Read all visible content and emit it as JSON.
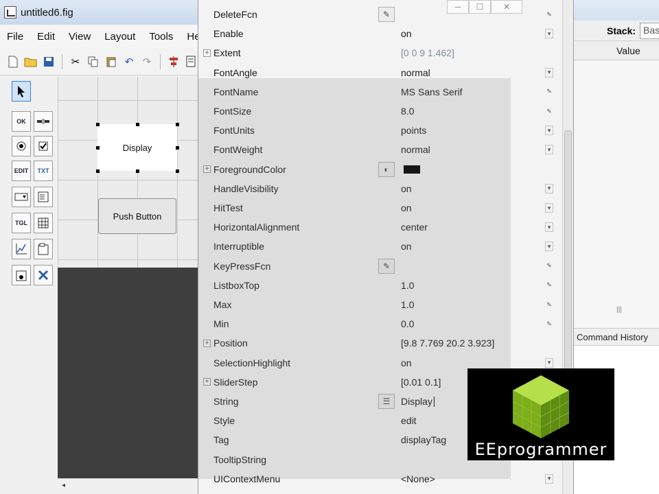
{
  "guide": {
    "title": "untitled6.fig",
    "menus": [
      "File",
      "Edit",
      "View",
      "Layout",
      "Tools",
      "Help"
    ],
    "display_control_label": "Display",
    "push_button_label": "Push Button"
  },
  "palette": {
    "ok_label": "OK",
    "edit_label": "EDIT",
    "txt_label": "TXT",
    "tgl_label": "TGL"
  },
  "workspace": {
    "stack_label": "Stack:",
    "stack_value": "Base",
    "value_column": "Value",
    "history_title": "Command History"
  },
  "inspector": {
    "properties": [
      {
        "name": "DeleteFcn",
        "value": "",
        "edit": "pencil",
        "ctl": "pencil"
      },
      {
        "name": "Enable",
        "value": "on",
        "ctl": "dd"
      },
      {
        "name": "Extent",
        "value": "[0 0 9 1.462]",
        "expand": true,
        "dim": true
      },
      {
        "name": "FontAngle",
        "value": "normal",
        "ctl": "dd"
      },
      {
        "name": "FontName",
        "value": "MS Sans Serif",
        "ctl": "pencil"
      },
      {
        "name": "FontSize",
        "value": "8.0",
        "ctl": "pencil"
      },
      {
        "name": "FontUnits",
        "value": "points",
        "ctl": "dd"
      },
      {
        "name": "FontWeight",
        "value": "normal",
        "ctl": "dd"
      },
      {
        "name": "ForegroundColor",
        "value": "",
        "expand": true,
        "edit": "palette",
        "swatch": "#000000"
      },
      {
        "name": "HandleVisibility",
        "value": "on",
        "ctl": "dd"
      },
      {
        "name": "HitTest",
        "value": "on",
        "ctl": "dd"
      },
      {
        "name": "HorizontalAlignment",
        "value": "center",
        "ctl": "dd"
      },
      {
        "name": "Interruptible",
        "value": "on",
        "ctl": "dd"
      },
      {
        "name": "KeyPressFcn",
        "value": "",
        "edit": "pencil",
        "ctl": "pencil"
      },
      {
        "name": "ListboxTop",
        "value": "1.0",
        "ctl": "pencil"
      },
      {
        "name": "Max",
        "value": "1.0",
        "ctl": "pencil"
      },
      {
        "name": "Min",
        "value": "0.0",
        "ctl": "pencil"
      },
      {
        "name": "Position",
        "value": "[9.8 7.769 20.2 3.923]",
        "expand": true
      },
      {
        "name": "SelectionHighlight",
        "value": "on",
        "ctl": "dd"
      },
      {
        "name": "SliderStep",
        "value": "[0.01 0.1]",
        "expand": true
      },
      {
        "name": "String",
        "value": "Display",
        "edit": "list",
        "cursor": true
      },
      {
        "name": "Style",
        "value": "edit",
        "ctl": "dd"
      },
      {
        "name": "Tag",
        "value": "displayTag",
        "ctl": "pencil"
      },
      {
        "name": "TooltipString",
        "value": "",
        "ctl": "pencil"
      },
      {
        "name": "UIContextMenu",
        "value": "<None>",
        "ctl": "dd"
      }
    ]
  },
  "watermark": {
    "brand": "EEprogrammer"
  },
  "colors": {
    "logo_green": "#8dc21f",
    "selection_blue": "#3c7fd0"
  }
}
